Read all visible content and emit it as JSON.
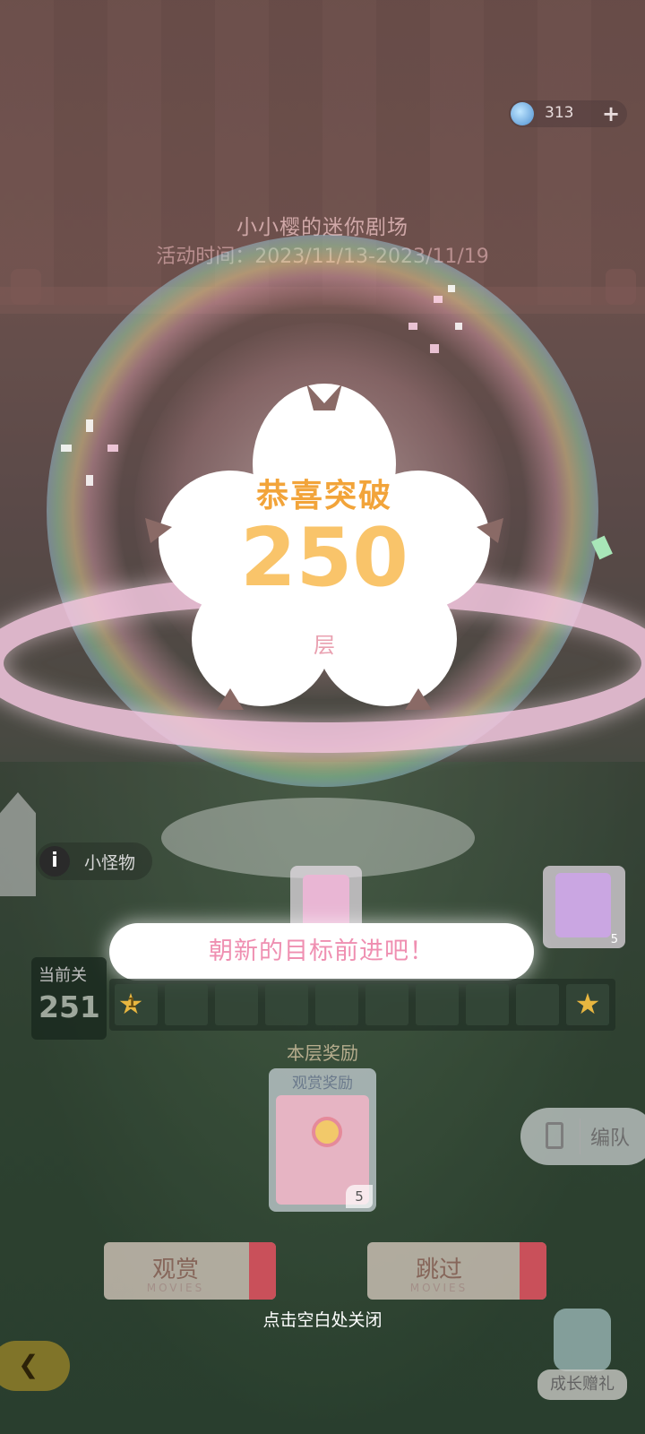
{
  "currency": {
    "icon": "crystal-gem-icon",
    "value": "313",
    "add_icon": "plus-icon"
  },
  "event": {
    "title": "小小樱的迷你剧场",
    "time": "活动时间：2023/11/13-2023/11/19"
  },
  "celebration": {
    "headline": "恭喜突破",
    "floor": "250",
    "unit": "层",
    "banner": "朝新的目标前进吧！"
  },
  "monster": {
    "icon": "info-icon",
    "label": "小怪物"
  },
  "level": {
    "current_label": "当前关",
    "current_value": "251",
    "start_badge": "1",
    "next_reward_count": "5"
  },
  "reward": {
    "section_title": "本层奖励",
    "card_title": "观赏奖励",
    "count": "5"
  },
  "team_button": {
    "label": "编队"
  },
  "actions": {
    "watch": {
      "label": "观赏",
      "sub": "MOVIES"
    },
    "skip": {
      "label": "跳过",
      "sub": "MOVIES"
    }
  },
  "close_hint": "点击空白处关闭",
  "growth_gift": {
    "label": "成长赠礼"
  },
  "colors": {
    "accent": "#f2a43a",
    "floor_number": "#f9c46a",
    "banner_text": "#ef8fb1"
  }
}
